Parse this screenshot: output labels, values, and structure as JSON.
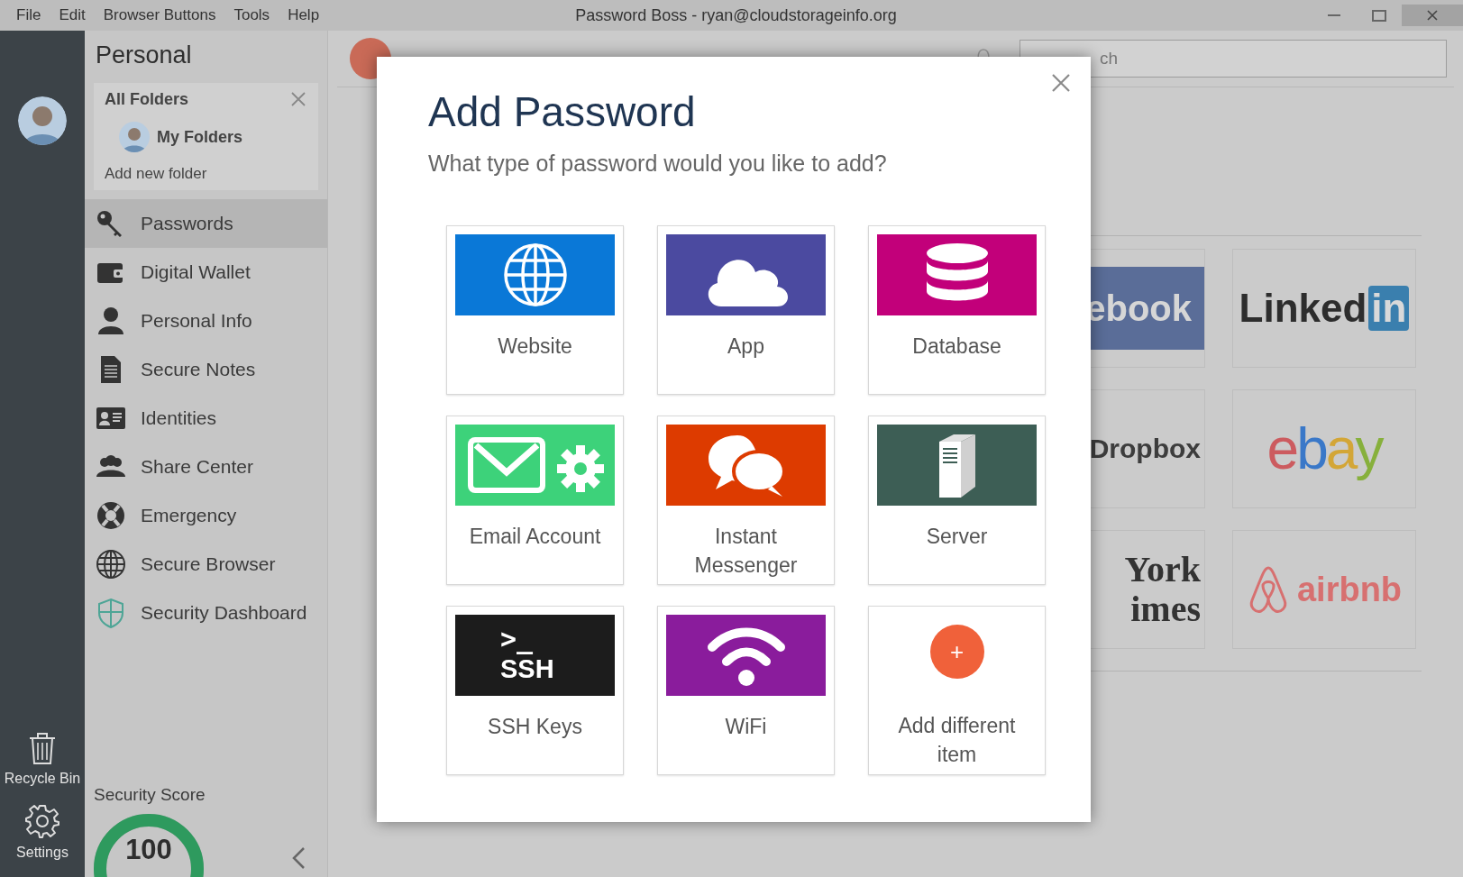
{
  "menu_bar": {
    "items": [
      "File",
      "Edit",
      "Browser Buttons",
      "Tools",
      "Help"
    ]
  },
  "window": {
    "title": "Password Boss - ryan@cloudstorageinfo.org"
  },
  "rail": {
    "items": [
      {
        "kind": "recycle",
        "label": "Recycle Bin"
      },
      {
        "kind": "settings",
        "label": "Settings"
      }
    ]
  },
  "sidebar": {
    "title": "Personal",
    "folders": {
      "heading": "All Folders",
      "items": [
        {
          "label": "My Folders"
        }
      ],
      "add_link": "Add new folder"
    },
    "nav": [
      {
        "kind": "key",
        "label": "Passwords",
        "selected": true
      },
      {
        "kind": "wallet",
        "label": "Digital Wallet",
        "selected": false
      },
      {
        "kind": "person",
        "label": "Personal Info",
        "selected": false
      },
      {
        "kind": "note",
        "label": "Secure Notes",
        "selected": false
      },
      {
        "kind": "idcard",
        "label": "Identities",
        "selected": false
      },
      {
        "kind": "group",
        "label": "Share Center",
        "selected": false
      },
      {
        "kind": "lifebuoy",
        "label": "Emergency",
        "selected": false
      },
      {
        "kind": "globe",
        "label": "Secure Browser",
        "selected": false
      },
      {
        "kind": "shield",
        "label": "Security Dashboard",
        "selected": false
      }
    ],
    "security_score": {
      "label": "Security Score",
      "value": "100",
      "level": 1
    }
  },
  "main": {
    "search": {
      "placeholder": "ch"
    },
    "logos": [
      {
        "kind": "facebook",
        "lines": [
          "ebook"
        ]
      },
      {
        "kind": "linkedin",
        "lines": [
          "Linked",
          "in"
        ]
      },
      {
        "kind": "dropbox",
        "lines": [
          "Dropbox"
        ]
      },
      {
        "kind": "ebay",
        "lines": [
          "ebay"
        ]
      },
      {
        "kind": "nytimes",
        "lines": [
          "York",
          "imes"
        ]
      },
      {
        "kind": "airbnb",
        "lines": [
          "airbnb"
        ]
      }
    ]
  },
  "dialog": {
    "title": "Add Password",
    "subtitle": "What type of password would you like to add?",
    "options": [
      {
        "kind": "website",
        "label": "Website"
      },
      {
        "kind": "app",
        "label": "App"
      },
      {
        "kind": "database",
        "label": "Database"
      },
      {
        "kind": "email",
        "label": "Email Account"
      },
      {
        "kind": "messenger",
        "label": "Instant Messenger"
      },
      {
        "kind": "server",
        "label": "Server"
      },
      {
        "kind": "ssh",
        "label": "SSH Keys",
        "art": [
          ">_",
          "SSH"
        ]
      },
      {
        "kind": "wifi",
        "label": "WiFi"
      },
      {
        "kind": "add",
        "label": "Add different item",
        "badge": "+"
      }
    ]
  }
}
